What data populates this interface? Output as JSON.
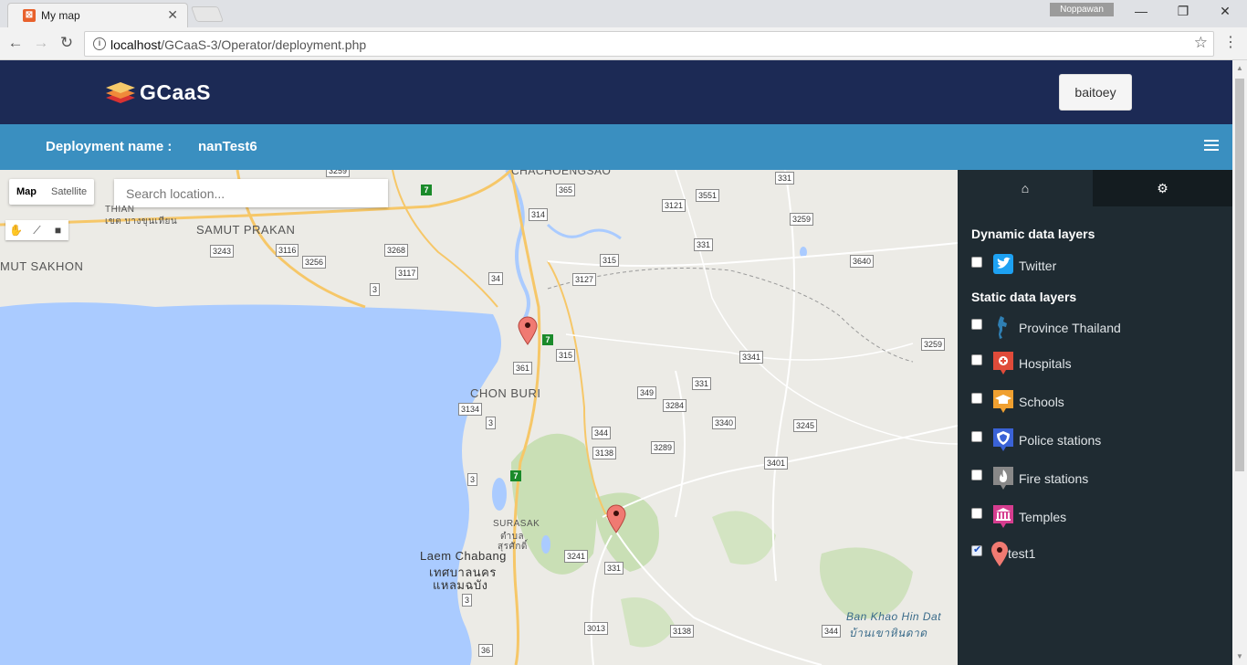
{
  "browser": {
    "tab_title": "My map",
    "user": "Noppawan",
    "url_host": "localhost",
    "url_path": "/GCaaS-3/Operator/deployment.php"
  },
  "header": {
    "logo": "GCaaS",
    "user_button": "baitoey"
  },
  "subbar": {
    "label": "Deployment name :",
    "name": "nanTest6"
  },
  "map": {
    "map_type_map": "Map",
    "map_type_satellite": "Satellite",
    "search_placeholder": "Search location...",
    "places": {
      "thian": "THIAN",
      "thian_th": "เขต บางขุนเทียน",
      "samut_prakan": "SAMUT PRAKAN",
      "samut_sakhon": "MUT SAKHON",
      "chachoengsao": "CHACHOENGSAO",
      "chon_buri": "CHON BURI",
      "surasak": "SURASAK",
      "surasak_th1": "ตำบล",
      "surasak_th2": "สุรศักดิ์",
      "laem_chabang": "Laem Chabang",
      "laem_chabang_th1": "เทศบาลนคร",
      "laem_chabang_th2": "แหลมฉบัง",
      "ban_khao": "Ban Khao Hin Dat",
      "ban_khao_th": "บ้านเขาหินดาด"
    },
    "roads": [
      "3259",
      "365",
      "3551",
      "331",
      "3121",
      "3259",
      "314",
      "331",
      "3243",
      "3116",
      "3256",
      "3268",
      "3117",
      "3",
      "34",
      "315",
      "3127",
      "3640",
      "361",
      "315",
      "3341",
      "3259",
      "349",
      "331",
      "3284",
      "3134",
      "3",
      "3340",
      "3245",
      "344",
      "3138",
      "3289",
      "3401",
      "3",
      "3241",
      "331",
      "3",
      "3013",
      "3138",
      "344",
      "36"
    ],
    "highways": [
      "7",
      "7",
      "7"
    ]
  },
  "sidebar": {
    "dynamic_title": "Dynamic data layers",
    "static_title": "Static data layers",
    "dynamic_layers": [
      {
        "label": "Twitter",
        "checked": false,
        "icon": "twitter-icon",
        "color": "#1da1f2"
      }
    ],
    "static_layers": [
      {
        "label": "Province Thailand",
        "checked": false,
        "icon": "thailand-map-icon",
        "color": "#2f7fb3"
      },
      {
        "label": "Hospitals",
        "checked": false,
        "icon": "hospital-icon",
        "color": "#e04b3a"
      },
      {
        "label": "Schools",
        "checked": false,
        "icon": "school-icon",
        "color": "#f0a030"
      },
      {
        "label": "Police stations",
        "checked": false,
        "icon": "police-icon",
        "color": "#3a62d6"
      },
      {
        "label": "Fire stations",
        "checked": false,
        "icon": "fire-icon",
        "color": "#888888"
      },
      {
        "label": "Temples",
        "checked": false,
        "icon": "temple-icon",
        "color": "#d63d8f"
      },
      {
        "label": "test1",
        "checked": true,
        "icon": "pin-icon",
        "color": "#f07a72"
      }
    ]
  }
}
